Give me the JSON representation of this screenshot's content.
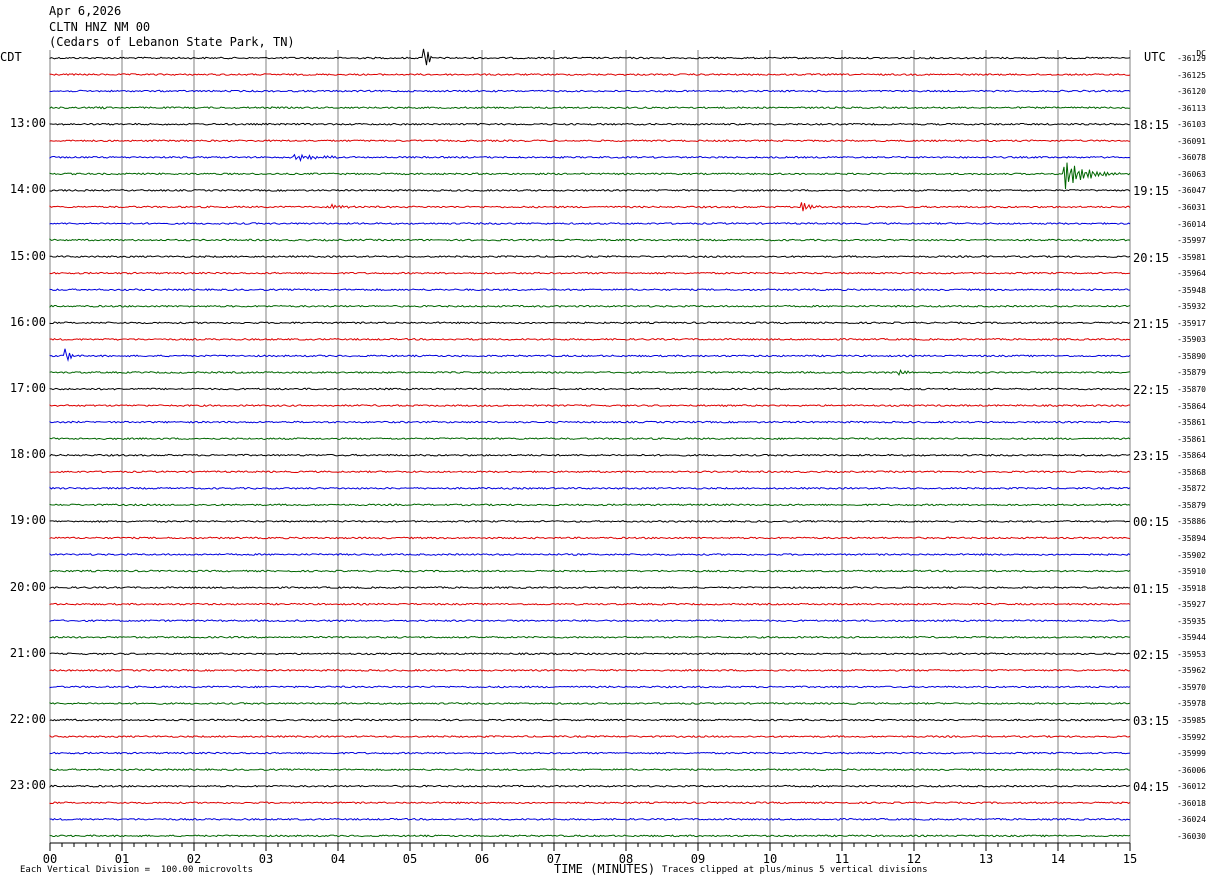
{
  "header": {
    "date": "Apr 6,2026",
    "station": "CLTN HNZ NM 00",
    "location": "(Cedars of Lebanon State Park, TN)"
  },
  "left_timezone": "CDT",
  "right_timezone": "UTC",
  "dc_label": "DC",
  "footer": {
    "vertical_division": "Each Vertical Division =  100.00 microvolts",
    "xlabel": "TIME (MINUTES)",
    "clip_note": "Traces clipped at plus/minus 5 vertical divisions"
  },
  "colors": {
    "cycle": [
      "#000000",
      "#dd0000",
      "#0000dd",
      "#006600"
    ],
    "grid": "#808080"
  },
  "chart_data": {
    "type": "line",
    "title": "CLTN HNZ NM 00",
    "xlabel": "TIME (MINUTES)",
    "xlim": [
      0,
      15
    ],
    "x_ticks": [
      "00",
      "01",
      "02",
      "03",
      "04",
      "05",
      "06",
      "07",
      "08",
      "09",
      "10",
      "11",
      "12",
      "13",
      "14",
      "15"
    ],
    "traces_per_hour": 4,
    "left_hour_labels": [
      "13:00",
      "14:00",
      "15:00",
      "16:00",
      "17:00",
      "18:00",
      "19:00",
      "20:00",
      "21:00",
      "22:00",
      "23:00"
    ],
    "right_hour_labels": [
      "18:15",
      "19:15",
      "20:15",
      "21:15",
      "22:15",
      "23:15",
      "00:15",
      "01:15",
      "02:15",
      "03:15",
      "04:15"
    ],
    "dc_offsets": [
      "-36129",
      "-36125",
      "-36120",
      "-36113",
      "-36103",
      "-36091",
      "-36078",
      "-36063",
      "-36047",
      "-36031",
      "-36014",
      "-35997",
      "-35981",
      "-35964",
      "-35948",
      "-35932",
      "-35917",
      "-35903",
      "-35890",
      "-35879",
      "-35870",
      "-35864",
      "-35861",
      "-35861",
      "-35864",
      "-35868",
      "-35872",
      "-35879",
      "-35886",
      "-35894",
      "-35902",
      "-35910",
      "-35918",
      "-35927",
      "-35935",
      "-35944",
      "-35953",
      "-35962",
      "-35970",
      "-35978",
      "-35985",
      "-35992",
      "-35999",
      "-36006",
      "-36012",
      "-36018",
      "-36024",
      "-36030"
    ],
    "events": [
      {
        "trace": 0,
        "minute": 5.2,
        "amplitude": 5
      },
      {
        "trace": 3,
        "minute": 0.7,
        "amplitude": 0.6
      },
      {
        "trace": 6,
        "minute": 3.4,
        "amplitude": 0.9,
        "duration": 1.0
      },
      {
        "trace": 7,
        "minute": 14.1,
        "amplitude": 4,
        "duration": 0.8
      },
      {
        "trace": 9,
        "minute": 3.9,
        "amplitude": 0.7,
        "duration": 0.5
      },
      {
        "trace": 9,
        "minute": 10.45,
        "amplitude": 2.0,
        "duration": 0.3
      },
      {
        "trace": 12,
        "minute": 12.95,
        "amplitude": 0.5
      },
      {
        "trace": 18,
        "minute": 0.22,
        "amplitude": 3.5
      },
      {
        "trace": 19,
        "minute": 11.8,
        "amplitude": 1.0,
        "duration": 0.3
      }
    ]
  }
}
